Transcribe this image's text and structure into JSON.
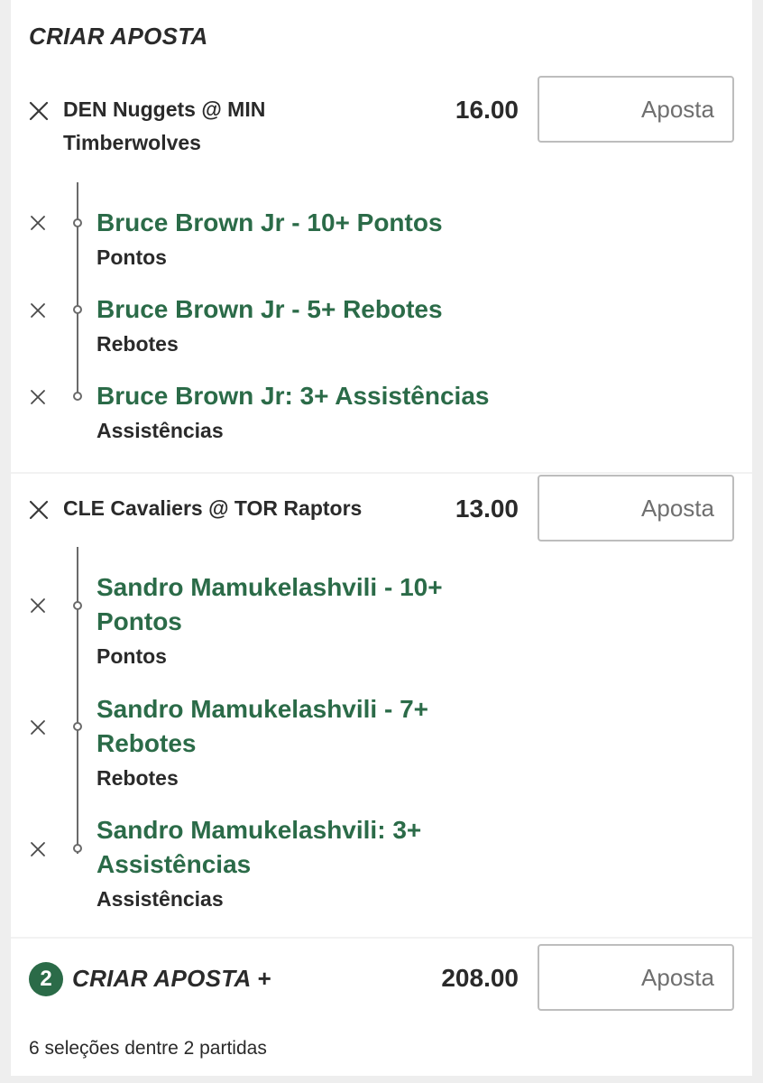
{
  "header": {
    "title": "CRIAR APOSTA"
  },
  "matches": [
    {
      "title_line1": "DEN Nuggets @ MIN",
      "title_line2": "Timberwolves",
      "odds": "16.00",
      "stake_placeholder": "Aposta",
      "selections": [
        {
          "title": "Bruce Brown Jr - 10+ Pontos",
          "market": "Pontos"
        },
        {
          "title": "Bruce Brown Jr - 5+ Rebotes",
          "market": "Rebotes"
        },
        {
          "title": "Bruce Brown Jr: 3+ Assistências",
          "market": "Assistências"
        }
      ]
    },
    {
      "title_line1": "CLE Cavaliers @ TOR Raptors",
      "odds": "13.00",
      "stake_placeholder": "Aposta",
      "selections": [
        {
          "title_line1": "Sandro Mamukelashvili - 10+",
          "title_line2": "Pontos",
          "market": "Pontos"
        },
        {
          "title_line1": "Sandro Mamukelashvili - 7+",
          "title_line2": "Rebotes",
          "market": "Rebotes"
        },
        {
          "title_line1": "Sandro Mamukelashvili: 3+",
          "title_line2": "Assistências",
          "market": "Assistências"
        }
      ]
    }
  ],
  "combo": {
    "count": "2",
    "label": "CRIAR APOSTA +",
    "odds": "208.00",
    "stake_placeholder": "Aposta"
  },
  "footer": {
    "summary": "6 seleções dentre 2 partidas"
  },
  "colors": {
    "accent_green": "#2b6b48",
    "text": "#2a2a2a",
    "border": "#bdbdbd"
  },
  "icons": {
    "remove": "close-icon",
    "timeline": "timeline-dot-icon"
  }
}
